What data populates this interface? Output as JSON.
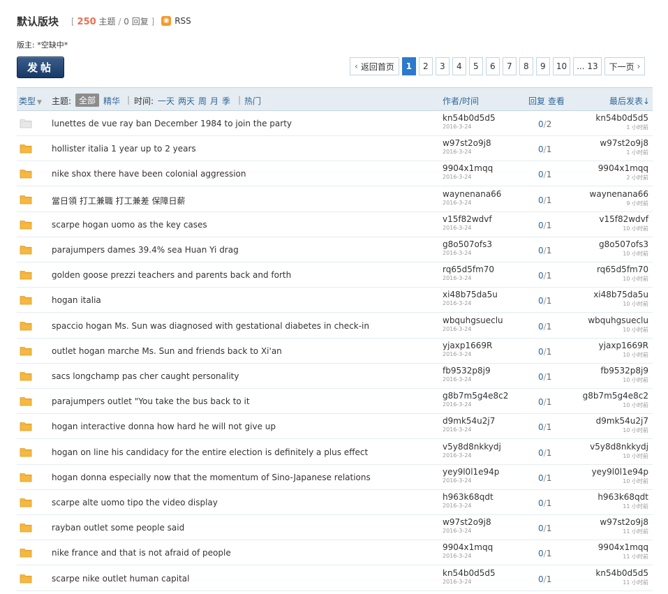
{
  "forum": {
    "title": "默认版块",
    "bracket_open": "[",
    "topics_count": "250",
    "topics_label": "主题",
    "slash": "/",
    "replies_count": "0",
    "replies_label": "回复",
    "bracket_close": "]",
    "rss_label": "RSS",
    "moderator": "版主: *空缺中*"
  },
  "toolbar": {
    "post_label": "发帖"
  },
  "pagination": {
    "back_label": "返回首页",
    "pages": [
      "1",
      "2",
      "3",
      "4",
      "5",
      "6",
      "7",
      "8",
      "9",
      "10"
    ],
    "current": "1",
    "last_label": "... 13",
    "next_label": "下一页"
  },
  "table_header": {
    "type_label": "类型",
    "topic_label": "主题:",
    "all_tab": "全部",
    "digest_tab": "精华",
    "sep1": "|",
    "time_label": "时间:",
    "time_filters": [
      "一天",
      "两天",
      "周",
      "月",
      "季"
    ],
    "sep2": "|",
    "hot_tab": "热门",
    "author_col": "作者/时间",
    "stats_col": "回复 查看",
    "last_col": "最后发表↓"
  },
  "threads": [
    {
      "title": "lunettes de vue ray ban December 1984 to join the party",
      "author": "kn54b0d5d5",
      "date": "2016-3-24",
      "replies": "0",
      "views": "2",
      "last_author": "kn54b0d5d5",
      "last_time": "1 小时前",
      "icon": "folder-gray"
    },
    {
      "title": "hollister italia 1 year up to 2 years",
      "author": "w97st2o9j8",
      "date": "2016-3-24",
      "replies": "0",
      "views": "1",
      "last_author": "w97st2o9j8",
      "last_time": "1 小时前",
      "icon": "folder"
    },
    {
      "title": "nike shox there have been colonial aggression",
      "author": "9904x1mqq",
      "date": "2016-3-24",
      "replies": "0",
      "views": "1",
      "last_author": "9904x1mqq",
      "last_time": "2 小时前",
      "icon": "folder"
    },
    {
      "title": "當日領 打工兼職 打工兼差 保障日薪",
      "author": "waynenana66",
      "date": "2016-3-24",
      "replies": "0",
      "views": "1",
      "last_author": "waynenana66",
      "last_time": "9 小时前",
      "icon": "folder"
    },
    {
      "title": "scarpe hogan uomo as the key cases",
      "author": "v15f82wdvf",
      "date": "2016-3-24",
      "replies": "0",
      "views": "1",
      "last_author": "v15f82wdvf",
      "last_time": "10 小时前",
      "icon": "folder"
    },
    {
      "title": "parajumpers dames 39.4% sea Huan Yi drag",
      "author": "g8o507ofs3",
      "date": "2016-3-24",
      "replies": "0",
      "views": "1",
      "last_author": "g8o507ofs3",
      "last_time": "10 小时前",
      "icon": "folder"
    },
    {
      "title": "golden goose prezzi teachers and parents back and forth",
      "author": "rq65d5fm70",
      "date": "2016-3-24",
      "replies": "0",
      "views": "1",
      "last_author": "rq65d5fm70",
      "last_time": "10 小时前",
      "icon": "folder"
    },
    {
      "title": "hogan italia",
      "author": "xi48b75da5u",
      "date": "2016-3-24",
      "replies": "0",
      "views": "1",
      "last_author": "xi48b75da5u",
      "last_time": "10 小时前",
      "icon": "folder"
    },
    {
      "title": "spaccio hogan Ms. Sun was diagnosed with gestational diabetes in check-in",
      "author": "wbquhgsueclu",
      "date": "2016-3-24",
      "replies": "0",
      "views": "1",
      "last_author": "wbquhgsueclu",
      "last_time": "10 小时前",
      "icon": "folder"
    },
    {
      "title": "outlet hogan marche Ms. Sun and friends back to Xi'an",
      "author": "yjaxp1669R",
      "date": "2016-3-24",
      "replies": "0",
      "views": "1",
      "last_author": "yjaxp1669R",
      "last_time": "10 小时前",
      "icon": "folder"
    },
    {
      "title": "sacs longchamp pas cher caught personality",
      "author": "fb9532p8j9",
      "date": "2016-3-24",
      "replies": "0",
      "views": "1",
      "last_author": "fb9532p8j9",
      "last_time": "10 小时前",
      "icon": "folder"
    },
    {
      "title": "parajumpers outlet \"You take the bus back to it",
      "author": "g8b7m5g4e8c2",
      "date": "2016-3-24",
      "replies": "0",
      "views": "1",
      "last_author": "g8b7m5g4e8c2",
      "last_time": "10 小时前",
      "icon": "folder"
    },
    {
      "title": "hogan interactive donna how hard he will not give up",
      "author": "d9mk54u2j7",
      "date": "2016-3-24",
      "replies": "0",
      "views": "1",
      "last_author": "d9mk54u2j7",
      "last_time": "10 小时前",
      "icon": "folder"
    },
    {
      "title": "hogan on line his candidacy for the entire election is definitely a plus effect",
      "author": "v5y8d8nkkydj",
      "date": "2016-3-24",
      "replies": "0",
      "views": "1",
      "last_author": "v5y8d8nkkydj",
      "last_time": "10 小时前",
      "icon": "folder"
    },
    {
      "title": "hogan donna especially now that the momentum of Sino-Japanese relations",
      "author": "yey9l0l1e94p",
      "date": "2016-3-24",
      "replies": "0",
      "views": "1",
      "last_author": "yey9l0l1e94p",
      "last_time": "10 小时前",
      "icon": "folder"
    },
    {
      "title": "scarpe alte uomo tipo the video display",
      "author": "h963k68qdt",
      "date": "2016-3-24",
      "replies": "0",
      "views": "1",
      "last_author": "h963k68qdt",
      "last_time": "11 小时前",
      "icon": "folder"
    },
    {
      "title": "rayban outlet some people said",
      "author": "w97st2o9j8",
      "date": "2016-3-24",
      "replies": "0",
      "views": "1",
      "last_author": "w97st2o9j8",
      "last_time": "11 小时前",
      "icon": "folder"
    },
    {
      "title": "nike france and that is not afraid of people",
      "author": "9904x1mqq",
      "date": "2016-3-24",
      "replies": "0",
      "views": "1",
      "last_author": "9904x1mqq",
      "last_time": "11 小时前",
      "icon": "folder"
    },
    {
      "title": "scarpe nike outlet human capital",
      "author": "kn54b0d5d5",
      "date": "2016-3-24",
      "replies": "0",
      "views": "1",
      "last_author": "kn54b0d5d5",
      "last_time": "11 小时前",
      "icon": "folder"
    }
  ],
  "colors": {
    "accent": "#2b7acd",
    "link": "#336699",
    "count": "#F26C4F",
    "header_bg": "#E5EDF2",
    "folder": "#F5B841"
  }
}
